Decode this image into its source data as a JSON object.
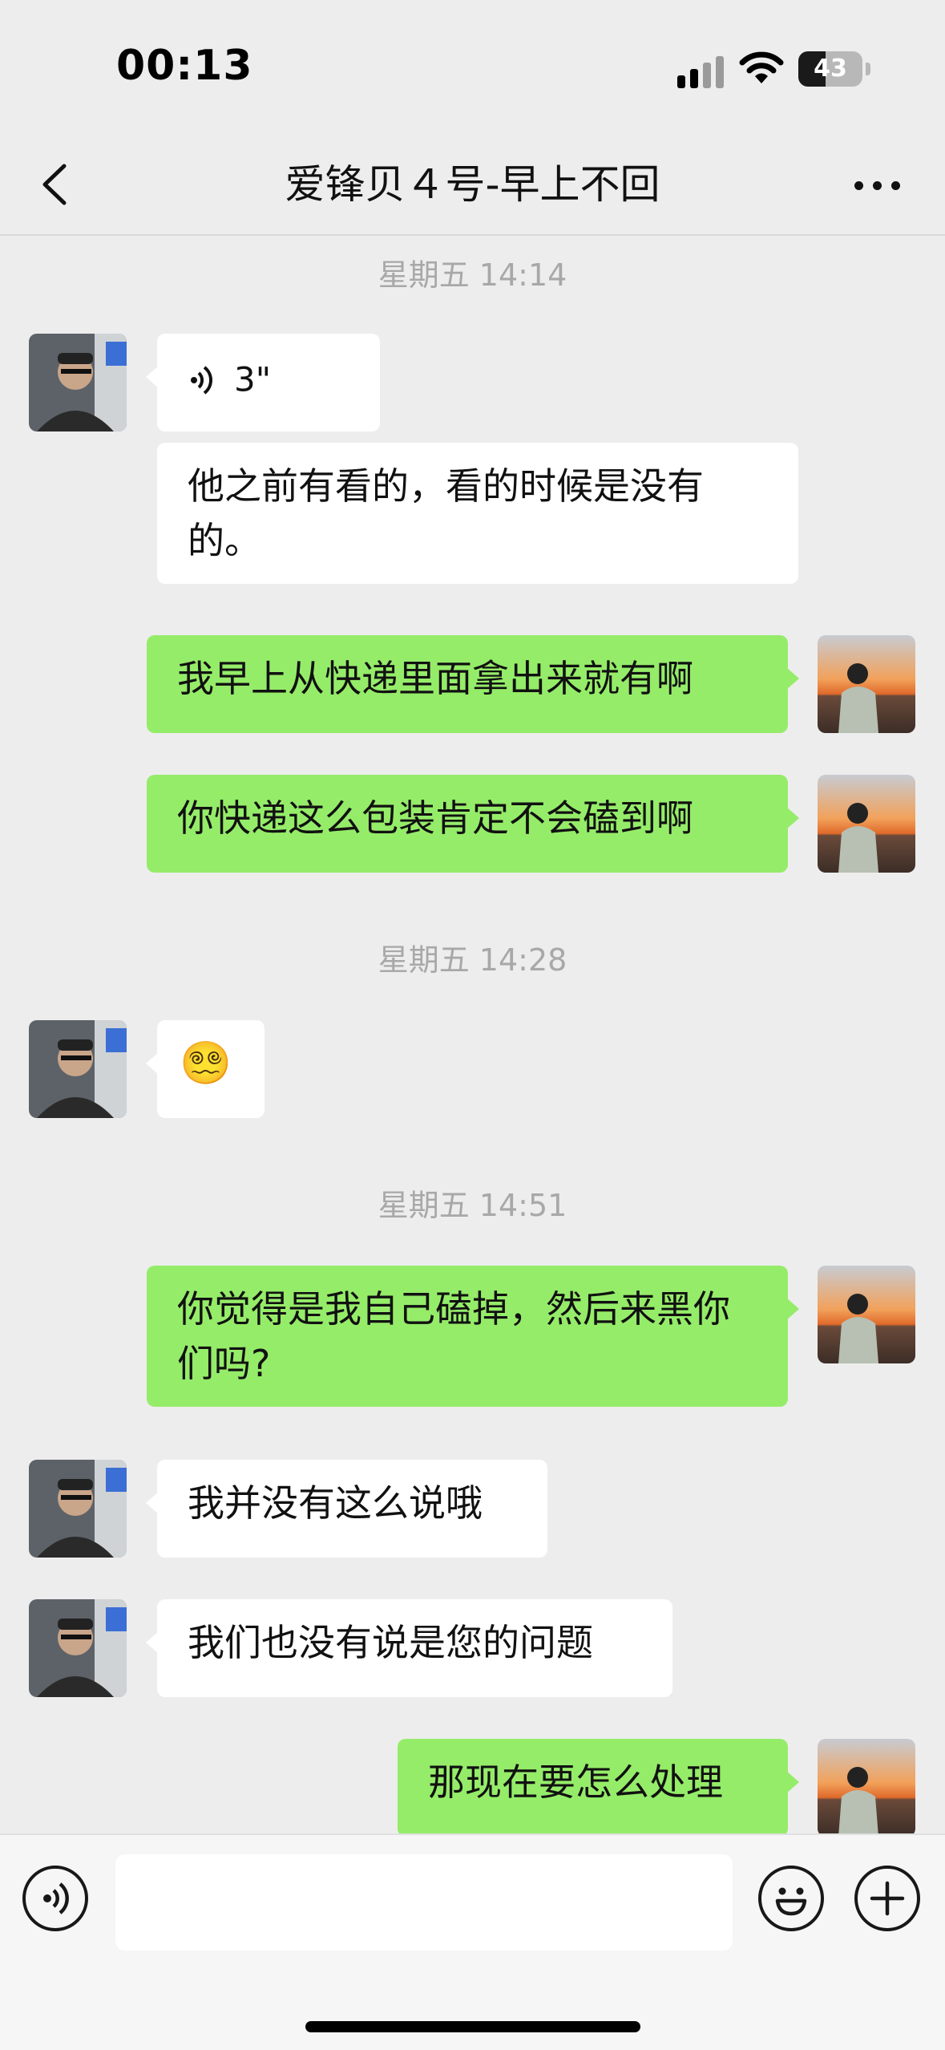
{
  "status_bar": {
    "time": "00:13",
    "battery": "43",
    "battery_level_percent": 43,
    "icons": [
      "signal-icon",
      "wifi-icon",
      "battery-icon"
    ]
  },
  "nav": {
    "title": "爱锋贝４号-早上不回",
    "back_icon": "chevron-left-icon",
    "more_icon": "ellipsis-icon"
  },
  "messages": {
    "ts1": "星期五 14:14",
    "m1_voice": "3\"",
    "m2": "他之前有看的，看的时候是没有的。",
    "m3": "我早上从快递里面拿出来就有啊",
    "m4": "你快递这么包装肯定不会磕到啊",
    "ts2": "星期五 14:28",
    "m5_emoji": "😵‍💫",
    "ts3": "星期五 14:51",
    "m6": "你觉得是我自己磕掉，然后来黑你们吗?",
    "m7": "我并没有这么说哦",
    "m8": "我们也没有说是您的问题",
    "m9": "那现在要怎么处理"
  },
  "input_bar": {
    "text_value": "",
    "icons": [
      "voice-icon",
      "emoji-icon",
      "plus-icon"
    ]
  },
  "colors": {
    "background": "#ededed",
    "incoming_bubble": "#ffffff",
    "outgoing_bubble": "#95ec69",
    "timestamp": "#a8a8a8"
  }
}
